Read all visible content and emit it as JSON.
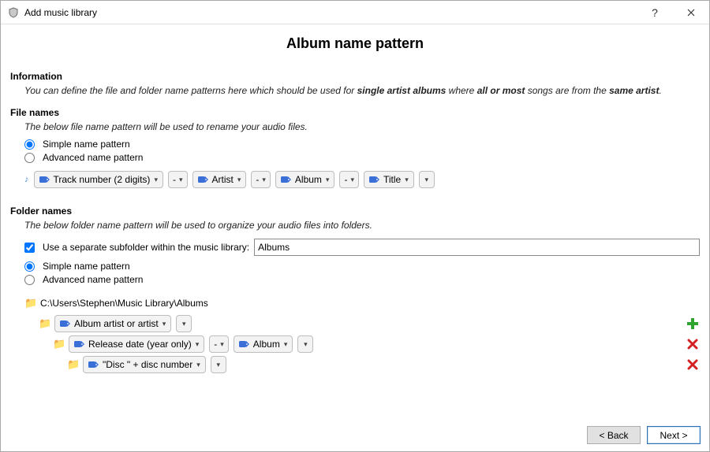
{
  "window": {
    "title": "Add music library"
  },
  "page": {
    "heading": "Album name pattern"
  },
  "information": {
    "header": "Information",
    "desc_prefix": "You can define the file and folder name patterns here which should be used for ",
    "desc_bold1": "single artist albums",
    "desc_mid": " where ",
    "desc_bold2": "all or most",
    "desc_mid2": " songs are from the ",
    "desc_bold3": "same artist",
    "desc_suffix": "."
  },
  "file_names": {
    "header": "File names",
    "desc": "The below file name pattern will be used to rename your audio files.",
    "radio_simple": "Simple name pattern",
    "radio_advanced": "Advanced name pattern",
    "tokens": [
      "Track number (2 digits)",
      "Artist",
      "Album",
      "Title"
    ],
    "separator": "-"
  },
  "folder_names": {
    "header": "Folder names",
    "desc": "The below folder name pattern will be used to organize your audio files into folders.",
    "subfolder_check": "Use a separate subfolder within the music library:",
    "subfolder_value": "Albums",
    "radio_simple": "Simple name pattern",
    "radio_advanced": "Advanced name pattern",
    "root_path": "C:\\Users\\Stephen\\Music Library\\Albums",
    "level1_token": "Album artist or artist",
    "level2_token1": "Release date (year only)",
    "level2_sep": "-",
    "level2_token2": "Album",
    "level3_token": "\"Disc \" + disc number"
  },
  "footer": {
    "back": "< Back",
    "next": "Next >"
  }
}
